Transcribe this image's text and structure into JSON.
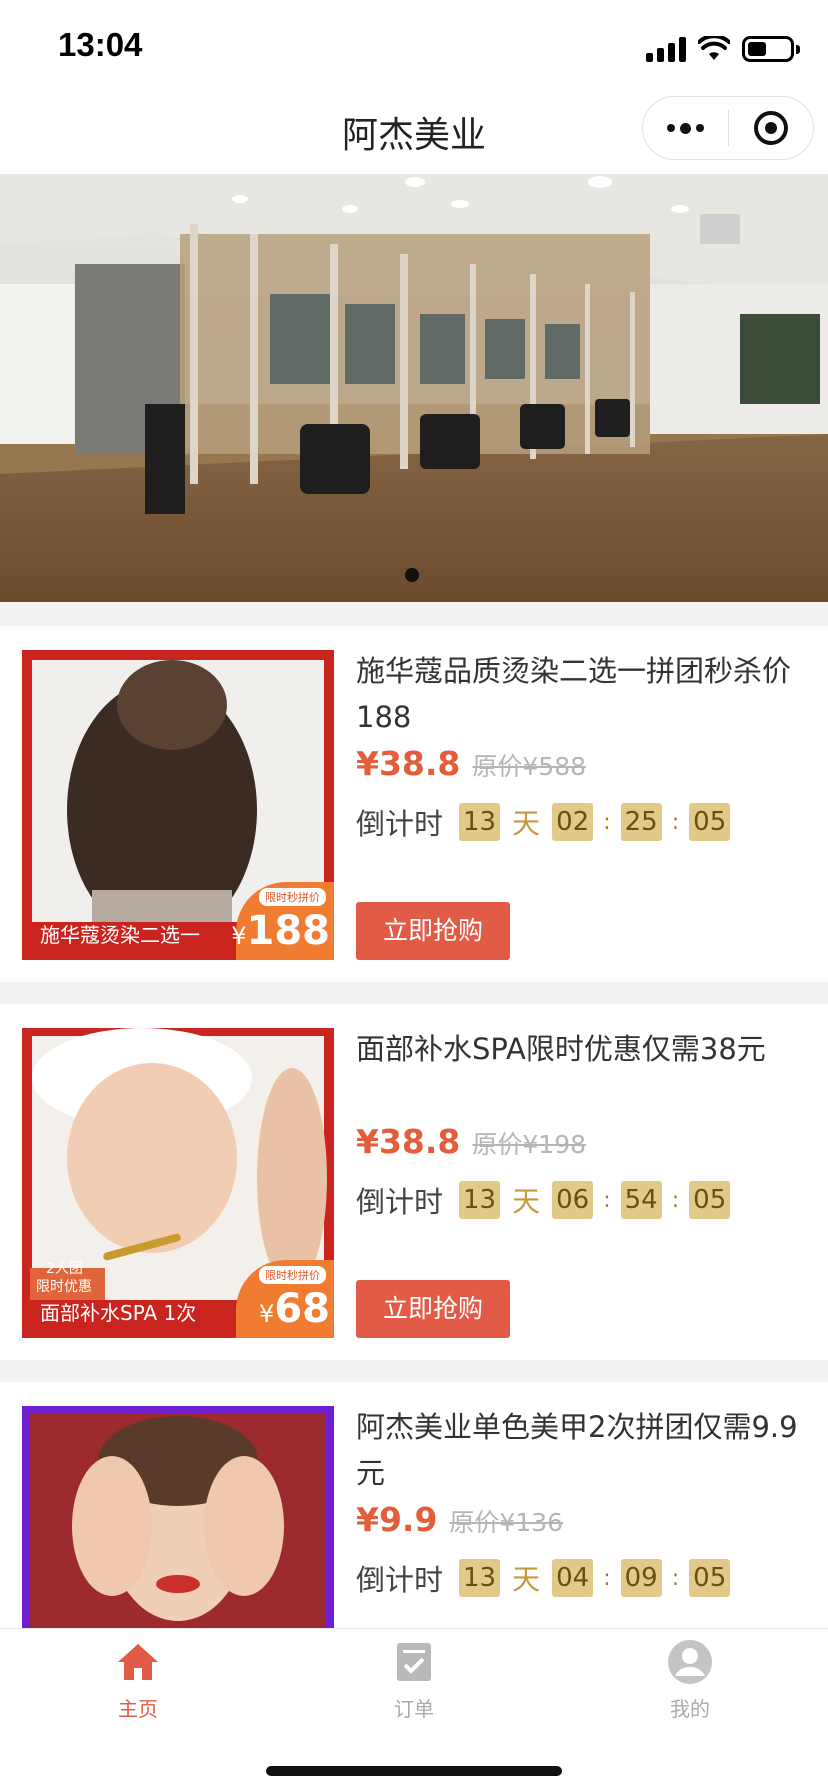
{
  "status_bar": {
    "time": "13:04"
  },
  "nav": {
    "title": "阿杰美业"
  },
  "products": [
    {
      "title": "施华蔻品质烫染二选一拼团秒杀价188",
      "price": "¥38.8",
      "original_price": "原价¥588",
      "countdown": {
        "label": "倒计时",
        "days": "13",
        "day_unit": "天",
        "hours": "02",
        "minutes": "25",
        "seconds": "05"
      },
      "buy_label": "立即抢购",
      "thumb_caption": "施华蔻烫染二选一",
      "badge_tag": "限时秒拼价",
      "badge_price": "188",
      "badge_currency": "¥"
    },
    {
      "title": "面部补水SPA限时优惠仅需38元",
      "price": "¥38.8",
      "original_price": "原价¥198",
      "countdown": {
        "label": "倒计时",
        "days": "13",
        "day_unit": "天",
        "hours": "06",
        "minutes": "54",
        "seconds": "05"
      },
      "buy_label": "立即抢购",
      "thumb_caption": "面部补水SPA 1次",
      "thumb_tag_1": "2人团",
      "thumb_tag_2": "限时优惠",
      "badge_tag": "限时秒拼价",
      "badge_price": "68",
      "badge_currency": "¥"
    },
    {
      "title": "阿杰美业单色美甲2次拼团仅需9.9元",
      "price": "¥9.9",
      "original_price": "原价¥136",
      "countdown": {
        "label": "倒计时",
        "days": "13",
        "day_unit": "天",
        "hours": "04",
        "minutes": "09",
        "seconds": "05"
      }
    }
  ],
  "tabs": [
    {
      "label": "主页",
      "icon": "home-icon",
      "active": true,
      "color": "#e25b47"
    },
    {
      "label": "订单",
      "icon": "order-icon",
      "active": false,
      "color": "#aaaaaa"
    },
    {
      "label": "我的",
      "icon": "profile-icon",
      "active": false,
      "color": "#aaaaaa"
    }
  ],
  "colors": {
    "accent": "#e25b47",
    "countdown_box": "#e2c98a",
    "price": "#e35d3b"
  }
}
